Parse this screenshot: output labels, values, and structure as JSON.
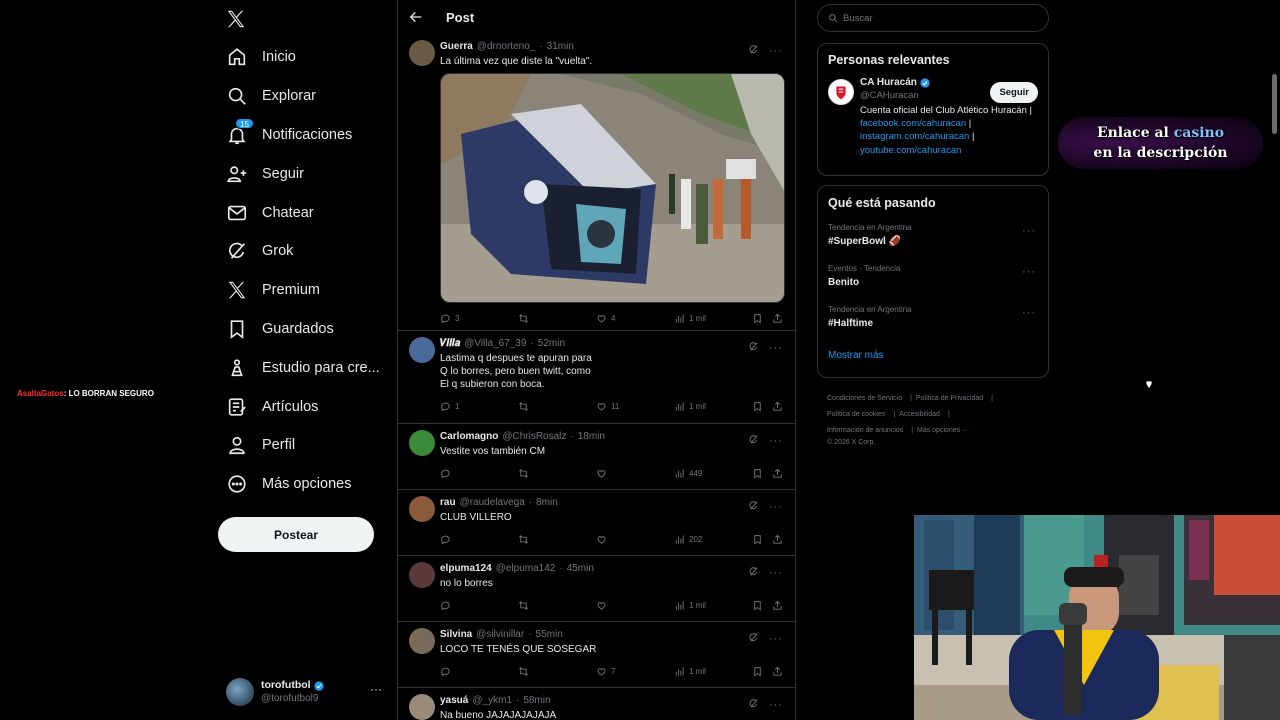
{
  "nav": {
    "items": [
      {
        "label": "Inicio",
        "icon": "home-icon"
      },
      {
        "label": "Explorar",
        "icon": "search-icon"
      },
      {
        "label": "Notificaciones",
        "icon": "bell-icon",
        "badge": "15"
      },
      {
        "label": "Seguir",
        "icon": "person-plus-icon"
      },
      {
        "label": "Chatear",
        "icon": "mail-icon"
      },
      {
        "label": "Grok",
        "icon": "grok-icon"
      },
      {
        "label": "Premium",
        "icon": "x-logo-icon"
      },
      {
        "label": "Guardados",
        "icon": "bookmark-icon"
      },
      {
        "label": "Estudio para cre...",
        "icon": "creator-studio-icon"
      },
      {
        "label": "Artículos",
        "icon": "article-icon"
      },
      {
        "label": "Perfil",
        "icon": "person-icon"
      },
      {
        "label": "Más opciones",
        "icon": "more-circle-icon"
      }
    ],
    "post_label": "Postear"
  },
  "account": {
    "name": "torofutbol",
    "handle": "@torofutbol9"
  },
  "overlay": {
    "user": "AsaltaGatos",
    "message": ": LO BORRAN SEGURO"
  },
  "header": {
    "title": "Post"
  },
  "tweets": [
    {
      "name": "Guerra",
      "handle": "@drnorteno_",
      "time": "31min",
      "text": [
        "La última vez que diste la \"vuelta\"."
      ],
      "replies": "3",
      "retweets": "",
      "likes": "4",
      "views": "1 mil",
      "has_media": true
    },
    {
      "name": "𝑽𝒊𝒍𝒍𝒂",
      "handle": "@Villa_67_39",
      "time": "52min",
      "text": [
        "Lastima q despues te apuran para",
        "Q lo borres, pero buen twitt, como",
        "El q subieron con boca."
      ],
      "replies": "1",
      "retweets": "",
      "likes": "11",
      "views": "1 mil"
    },
    {
      "name": "Carlomagno",
      "handle": "@ChrisRosalz",
      "time": "18min",
      "text": [
        "Vestite vos también CM"
      ],
      "replies": "",
      "retweets": "",
      "likes": "",
      "views": "449"
    },
    {
      "name": "rau",
      "handle": "@raudelavega",
      "time": "8min",
      "text": [
        "CLUB VILLERO"
      ],
      "replies": "",
      "retweets": "",
      "likes": "",
      "views": "202"
    },
    {
      "name": "elpuma124",
      "handle": "@elpuma142",
      "time": "45min",
      "text": [
        "no lo borres"
      ],
      "replies": "",
      "retweets": "",
      "likes": "",
      "views": "1 mil"
    },
    {
      "name": "Silvina",
      "handle": "@silvinillar",
      "time": "55min",
      "text": [
        "LOCO TE TENÉS QUE SOSEGAR"
      ],
      "replies": "",
      "retweets": "",
      "likes": "7",
      "views": "1 mil"
    },
    {
      "name": "yasuá",
      "handle": "@_ykm1",
      "time": "58min",
      "text": [
        "Na bueno JAJAJAJAJAJA"
      ],
      "replies": "",
      "retweets": "",
      "likes": "",
      "views": ""
    }
  ],
  "search": {
    "placeholder": "Buscar"
  },
  "relevant": {
    "title": "Personas relevantes",
    "name": "CA Huracán",
    "handle": "@CAHuracan",
    "follow_label": "Seguir",
    "bio_text1": "Cuenta oficial del Club Atlético Huracán | ",
    "link1": "facebook.com/cahuracan",
    "sep1": " | ",
    "link2": "instagram.com/cahuracan",
    "sep2": " | ",
    "link3": "youtube.com/cahuracan"
  },
  "trends": {
    "title": "Qué está pasando",
    "items": [
      {
        "context": "Tendencia en Argentina",
        "topic": "#SuperBowl 🏈"
      },
      {
        "context": "Eventos · Tendencia",
        "topic": "Benito"
      },
      {
        "context": "Tendencia en Argentina",
        "topic": "#Halftime"
      }
    ],
    "show_more": "Mostrar más"
  },
  "footer": {
    "links": [
      "Condiciones de Servicio",
      "Política de Privacidad",
      "Política de cookies",
      "Accesibilidad",
      "Información de anuncios",
      "Más opciones ···"
    ],
    "copyright": "© 2026 X Corp."
  },
  "promo": {
    "line1_a": "Enlace al ",
    "line1_b": "casino",
    "line2": "en la descripción"
  },
  "colors": {
    "accent": "#1d9bf0",
    "background": "#000000",
    "border": "#2f3336",
    "muted": "#71767b"
  }
}
